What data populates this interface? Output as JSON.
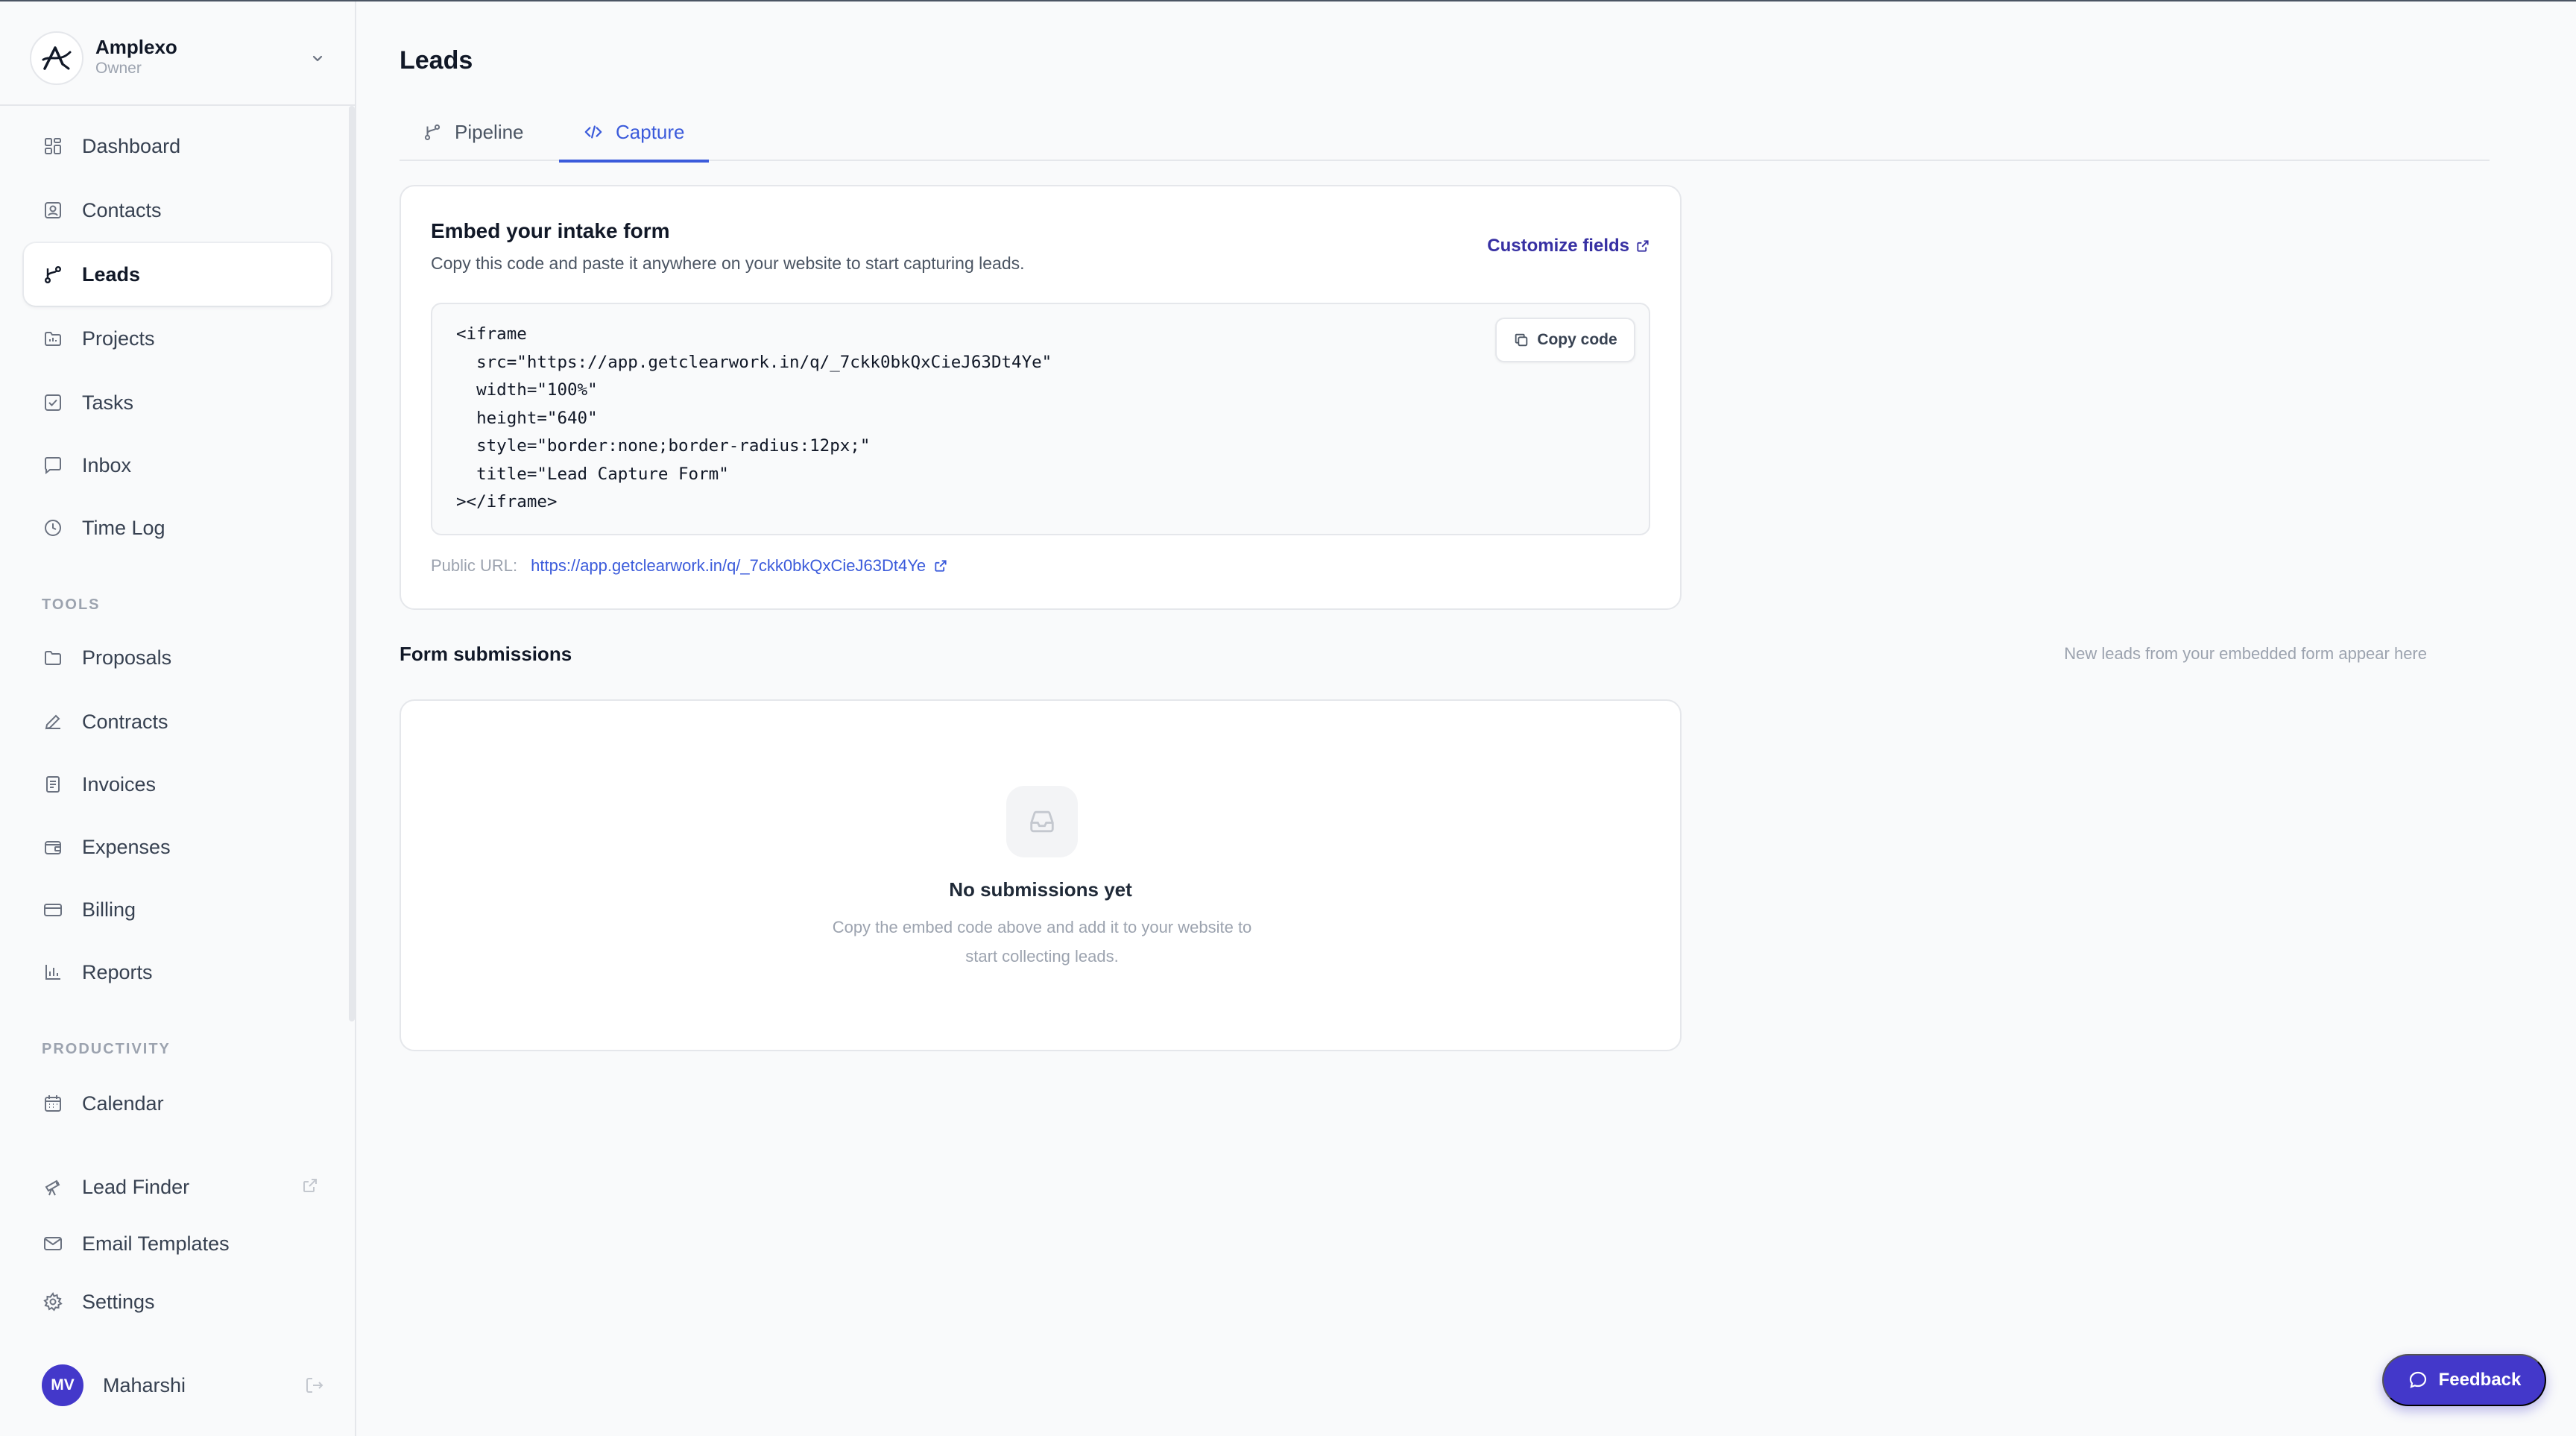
{
  "workspace": {
    "name": "Amplexo",
    "role": "Owner"
  },
  "sidebar": {
    "main_items": [
      {
        "label": "Dashboard",
        "icon": "dashboard-icon"
      },
      {
        "label": "Contacts",
        "icon": "contacts-icon"
      },
      {
        "label": "Leads",
        "icon": "leads-icon",
        "active": true
      },
      {
        "label": "Projects",
        "icon": "projects-icon"
      },
      {
        "label": "Tasks",
        "icon": "tasks-icon"
      },
      {
        "label": "Inbox",
        "icon": "inbox-icon"
      },
      {
        "label": "Time Log",
        "icon": "clock-icon"
      }
    ],
    "tools_label": "TOOLS",
    "tools_items": [
      {
        "label": "Proposals",
        "icon": "proposals-icon"
      },
      {
        "label": "Contracts",
        "icon": "pen-icon"
      },
      {
        "label": "Invoices",
        "icon": "invoice-icon"
      },
      {
        "label": "Expenses",
        "icon": "wallet-icon"
      },
      {
        "label": "Billing",
        "icon": "credit-card-icon"
      },
      {
        "label": "Reports",
        "icon": "bar-chart-icon"
      }
    ],
    "productivity_label": "PRODUCTIVITY",
    "productivity_items": [
      {
        "label": "Calendar",
        "icon": "calendar-icon"
      }
    ],
    "extra_items": [
      {
        "label": "Lead Finder",
        "icon": "telescope-icon"
      },
      {
        "label": "Email Templates",
        "icon": "mail-icon"
      },
      {
        "label": "Settings",
        "icon": "gear-icon"
      }
    ],
    "user": {
      "initials": "MV",
      "name": "Maharshi"
    }
  },
  "page": {
    "title": "Leads",
    "tabs": [
      {
        "label": "Pipeline",
        "icon": "branch-icon"
      },
      {
        "label": "Capture",
        "icon": "code-icon",
        "active": true
      }
    ]
  },
  "embed": {
    "title": "Embed your intake form",
    "description": "Copy this code and paste it anywhere on your website to start capturing leads.",
    "customize_label": "Customize fields",
    "code": "<iframe\n  src=\"https://app.getclearwork.in/q/_7ckk0bkQxCieJ63Dt4Ye\"\n  width=\"100%\"\n  height=\"640\"\n  style=\"border:none;border-radius:12px;\"\n  title=\"Lead Capture Form\"\n></iframe>",
    "copy_label": "Copy code",
    "public_url_label": "Public URL:",
    "public_url": "https://app.getclearwork.in/q/_7ckk0bkQxCieJ63Dt4Ye"
  },
  "submissions": {
    "title": "Form submissions",
    "hint": "New leads from your embedded form appear here",
    "empty_title": "No submissions yet",
    "empty_desc": "Copy the embed code above and add it to your website to start collecting leads."
  },
  "feedback_label": "Feedback",
  "colors": {
    "accent": "#3b5bdb",
    "brand": "#4338ca"
  }
}
